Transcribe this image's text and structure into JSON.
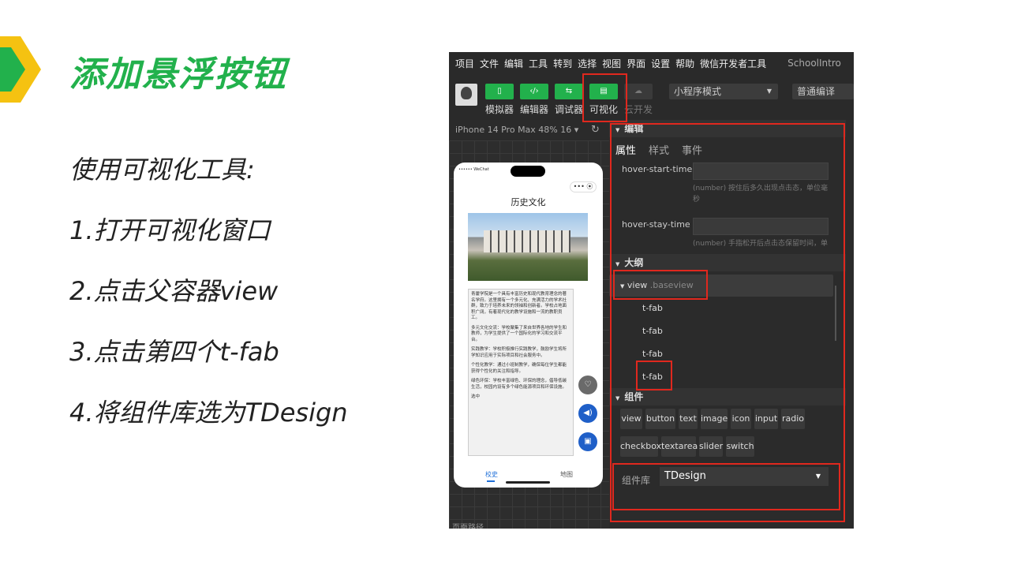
{
  "slide": {
    "title": "添加悬浮按钮",
    "steps": [
      "使用可视化工具:",
      "1.打开可视化窗口",
      "2.点击父容器view",
      "3.点击第四个t-fab",
      "4.将组件库选为TDesign"
    ],
    "accent_color": "#22b14c",
    "chevron_colors": [
      "#22b14c",
      "#f5c211"
    ]
  },
  "screenshot": {
    "menu": [
      "项目",
      "文件",
      "编辑",
      "工具",
      "转到",
      "选择",
      "视图",
      "界面",
      "设置",
      "帮助",
      "微信开发者工具"
    ],
    "app_title": "SchoolIntro",
    "toolbar": {
      "buttons": [
        {
          "label": "模拟器",
          "icon": "phone-icon"
        },
        {
          "label": "编辑器",
          "icon": "code-icon"
        },
        {
          "label": "调试器",
          "icon": "debug-icon"
        },
        {
          "label": "可视化",
          "icon": "layout-icon"
        },
        {
          "label": "云开发",
          "icon": "cloud-icon",
          "disabled": true
        }
      ],
      "mode_select": "小程序模式",
      "compile_select": "普通编译"
    },
    "simulator": {
      "device": "iPhone 14 Pro Max 48% 16 ▾",
      "status_carrier": "•••••• WeChat",
      "capsule": "••• ⦿",
      "page_title": "历史文化",
      "paragraphs": [
        "青藿学院是一个具有丰富历史和现代教育理念的著名学府。这里拥有一个多元化、充满活力的学术社群，致力于培养未来的领袖和创新者。学校占地面积广阔，有着现代化的教学设施和一流的教职员工。",
        "多元文化交流：学校聚集了来自世界各地的学生和教师，为学生提供了一个国际化的学习和交流平台。",
        "实践教学：学校积极推行实践教学，鼓励学生将所学知识应用于实际项目和社会服务中。",
        "个性化教学：通过小班制教学，确保每位学生都能获得个性化的关注和指导。",
        "绿色环保：学校丰富绿色、环保的理念，倡导低碳生活，校园内设有多个绿色能源项目和环保设施。",
        "选中"
      ],
      "tabs": [
        "校史",
        "地图"
      ],
      "footer": "页面路径"
    },
    "panel": {
      "section_edit": "编辑",
      "prop_tabs": [
        "属性",
        "样式",
        "事件"
      ],
      "props": [
        {
          "name": "hover-start-time",
          "hint": "(number) 按住后多久出现点击态，单位毫秒"
        },
        {
          "name": "hover-stay-time",
          "hint": "(number) 手指松开后点击态保留时间，单"
        }
      ],
      "section_outline": "大纲",
      "outline": {
        "root_tag": "view",
        "root_class": ".baseview",
        "children": [
          "t-fab",
          "t-fab",
          "t-fab",
          "t-fab"
        ]
      },
      "section_components": "组件",
      "components_row1": [
        "view",
        "button",
        "text",
        "image",
        "icon",
        "input",
        "radio"
      ],
      "components_row2": [
        "checkbox",
        "textarea",
        "slider",
        "switch"
      ],
      "library_label": "组件库",
      "library_value": "TDesign"
    }
  }
}
